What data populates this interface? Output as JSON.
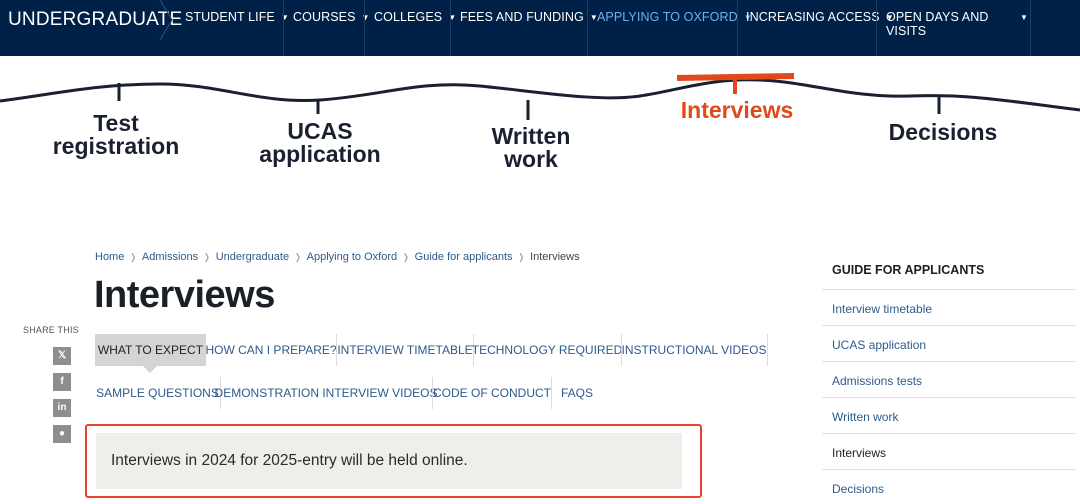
{
  "nav": {
    "brand": "UNDERGRADUATE",
    "items": [
      {
        "label": "STUDENT LIFE",
        "line2": ""
      },
      {
        "label": "COURSES",
        "line2": ""
      },
      {
        "label": "COLLEGES",
        "line2": ""
      },
      {
        "label": "FEES AND FUNDING",
        "line2": ""
      },
      {
        "label": "APPLYING TO OXFORD",
        "line2": ""
      },
      {
        "label": "INCREASING ACCESS",
        "line2": ""
      },
      {
        "label": "OPEN DAYS AND",
        "line2": "VISITS"
      }
    ],
    "caret": "▼",
    "active_index": 4,
    "active_color": "#6cb0ef",
    "background": "#002147"
  },
  "journey": {
    "steps": [
      {
        "line1": "Test",
        "line2": "registration"
      },
      {
        "line1": "UCAS",
        "line2": "application"
      },
      {
        "line1": "Written",
        "line2": "work"
      },
      {
        "line1": "Interviews",
        "line2": ""
      },
      {
        "line1": "Decisions",
        "line2": ""
      }
    ],
    "active_index": 3,
    "active_color": "#e04a1b"
  },
  "breadcrumb": {
    "items": [
      "Home",
      "Admissions",
      "Undergraduate",
      "Applying to Oxford",
      "Guide for applicants",
      "Interviews"
    ],
    "separator": "❭"
  },
  "page": {
    "title": "Interviews"
  },
  "share": {
    "label": "SHARE THIS",
    "buttons": [
      {
        "icon": "x-icon",
        "glyph": "𝕏"
      },
      {
        "icon": "facebook-icon",
        "glyph": "f"
      },
      {
        "icon": "linkedin-icon",
        "glyph": "in"
      },
      {
        "icon": "reddit-icon",
        "glyph": "●"
      }
    ]
  },
  "tabs": {
    "row1": [
      "WHAT TO EXPECT",
      "HOW CAN I PREPARE?",
      "INTERVIEW TIMETABLE",
      "TECHNOLOGY REQUIRED",
      "INSTRUCTIONAL VIDEOS"
    ],
    "row2": [
      "SAMPLE QUESTIONS",
      "DEMONSTRATION INTERVIEW VIDEOS",
      "CODE OF CONDUCT",
      "FAQS"
    ],
    "active": "WHAT TO EXPECT"
  },
  "notice": {
    "text": "Interviews in 2024 for 2025-entry will be held online.",
    "highlight_color": "#e8432f"
  },
  "sidebar": {
    "title": "GUIDE FOR APPLICANTS",
    "items": [
      "Interview timetable",
      "UCAS application",
      "Admissions tests",
      "Written work",
      "Interviews",
      "Decisions"
    ],
    "current_index": 4
  }
}
